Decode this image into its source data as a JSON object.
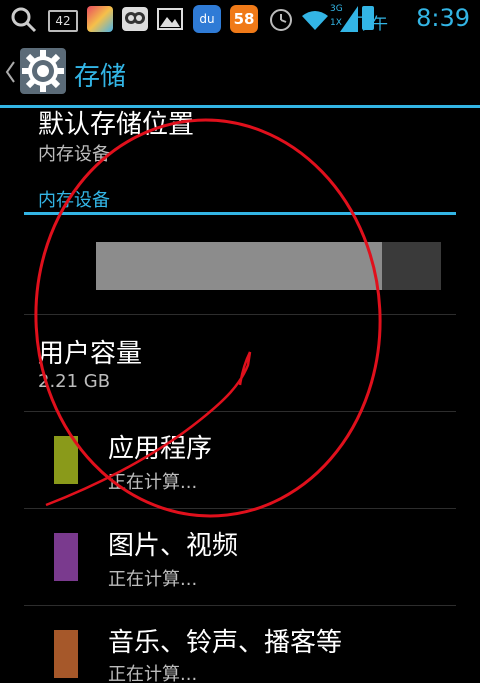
{
  "status_bar": {
    "icons": [
      "search-icon",
      "battery-level-icon",
      "app-icon",
      "chat-icon",
      "gallery-icon",
      "baidu-icon",
      "app-58-icon",
      "alarm-icon",
      "wifi-icon",
      "signal-icon",
      "battery-icon"
    ],
    "battery_badge": "42",
    "badge_58": "58",
    "net_3g": "3G",
    "net_1x": "1X",
    "ampm": "下午",
    "time": "8:39",
    "accent": "#33b5e5"
  },
  "action_bar": {
    "title": "存储",
    "back_icon": "chevron-left-icon",
    "settings_icon": "gear-icon"
  },
  "default_location": {
    "title": "默认存储位置",
    "value": "内存设备"
  },
  "internal": {
    "section_header": "内存设备",
    "usage_bar": {
      "used_fraction": 0.83,
      "used_color": "#8c8c8c",
      "free_color": "#3a3a3a"
    },
    "user_capacity_title": "用户容量",
    "user_capacity_value": "2.21 GB"
  },
  "items": [
    {
      "label": "应用程序",
      "status": "正在计算...",
      "color": "#8a9a1a"
    },
    {
      "label": "图片、视频",
      "status": "正在计算...",
      "color": "#7a3a8e"
    },
    {
      "label": "音乐、铃声、播客等",
      "status": "正在计算...",
      "color": "#a6582a"
    }
  ],
  "annotation_color": "#e0101c"
}
